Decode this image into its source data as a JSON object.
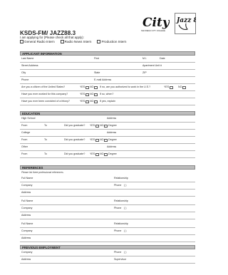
{
  "header": {
    "title": "KSDS-FM/ JAZZ88.3",
    "subtitle": "I am applying for (Please check all that apply):",
    "options": [
      "General Radio Intern",
      "Radio News Intern",
      "Production Intern"
    ],
    "logo_city_text": "City",
    "logo_city_caption": "SAN DIEGO CITY COLLEGE",
    "logo_jazz_text": "Jazz 88.3"
  },
  "sections": {
    "applicant": "APPLICANT INFORMATION",
    "education": "EDUCATION",
    "references": "REFERENCES",
    "employment": "PREVIOUS EMPLOYMENT"
  },
  "applicant": {
    "last_name": "Last Name",
    "first": "First",
    "mi": "M.I.",
    "date": "Date",
    "street": "Street Address",
    "apt": "Apartment Unit #",
    "city": "City",
    "state": "State",
    "zip": "ZIP",
    "phone": "Phone",
    "email": "E-mail Address",
    "citizen_q": "Are you a citizen of the United States?",
    "authorized_q": "If no, are you authorized to work in the U.S.?",
    "worked_q": "Have you ever worked for this company?",
    "when": "If so, when?",
    "convicted_q": "Have you ever been convicted of a felony?",
    "explain": "If yes, explain",
    "yes": "YES",
    "no": "NO"
  },
  "education": {
    "high_school": "High School",
    "college": "College",
    "other": "Other",
    "address": "Address",
    "from": "From",
    "to": "To",
    "graduate": "Did you graduate?",
    "yes": "YES",
    "no": "NO",
    "degree": "Degree"
  },
  "references": {
    "note": "Please list three professional references.",
    "full_name": "Full Name",
    "relationship": "Relationship",
    "company": "Company",
    "phone": "Phone",
    "phone_paren": "(        )",
    "address": "Address"
  },
  "employment": {
    "company": "Company",
    "phone": "Phone",
    "phone_paren": "(        )",
    "address": "Address",
    "supervisor": "Supervisor"
  }
}
